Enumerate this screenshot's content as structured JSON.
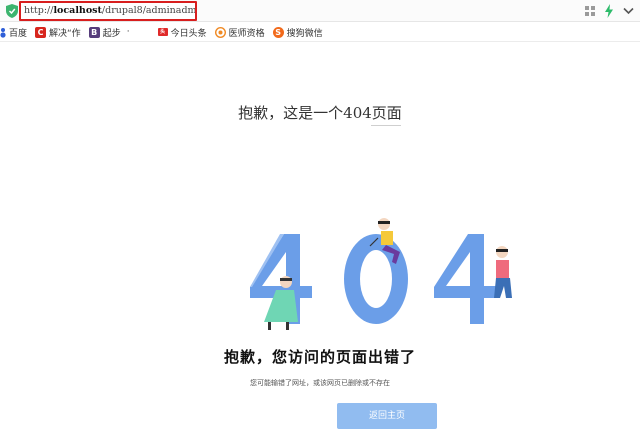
{
  "address_bar": {
    "url_prefix": "http://",
    "url_host": "localhost",
    "url_path": "/drupal8/adminadmin"
  },
  "bookmarks": [
    {
      "label": "百度",
      "icon": "paw-icon"
    },
    {
      "label": "解决“作",
      "icon": "c-red-icon"
    },
    {
      "label": "起步",
      "icon": "b-purple-icon"
    },
    {
      "label": "·",
      "icon": ""
    },
    {
      "label": "今日头条",
      "icon": "toutiao-icon"
    },
    {
      "label": "医师资格",
      "icon": "orange-circle-icon"
    },
    {
      "label": "搜狗微信",
      "icon": "sogou-icon"
    }
  ],
  "page": {
    "title": "抱歉，这是一个404页面",
    "headline": "抱歉，您访问的页面出错了",
    "subline": "您可能输错了网址，或该网页已删除或不存在",
    "home_button": "返回主页"
  },
  "illustration": {
    "digits": [
      "4",
      "0",
      "4"
    ],
    "color": "#6b9ee8"
  },
  "colors": {
    "highlight_border": "#d81e1e",
    "button_bg": "#91bcf0",
    "digit_blue": "#6b9ee8"
  }
}
